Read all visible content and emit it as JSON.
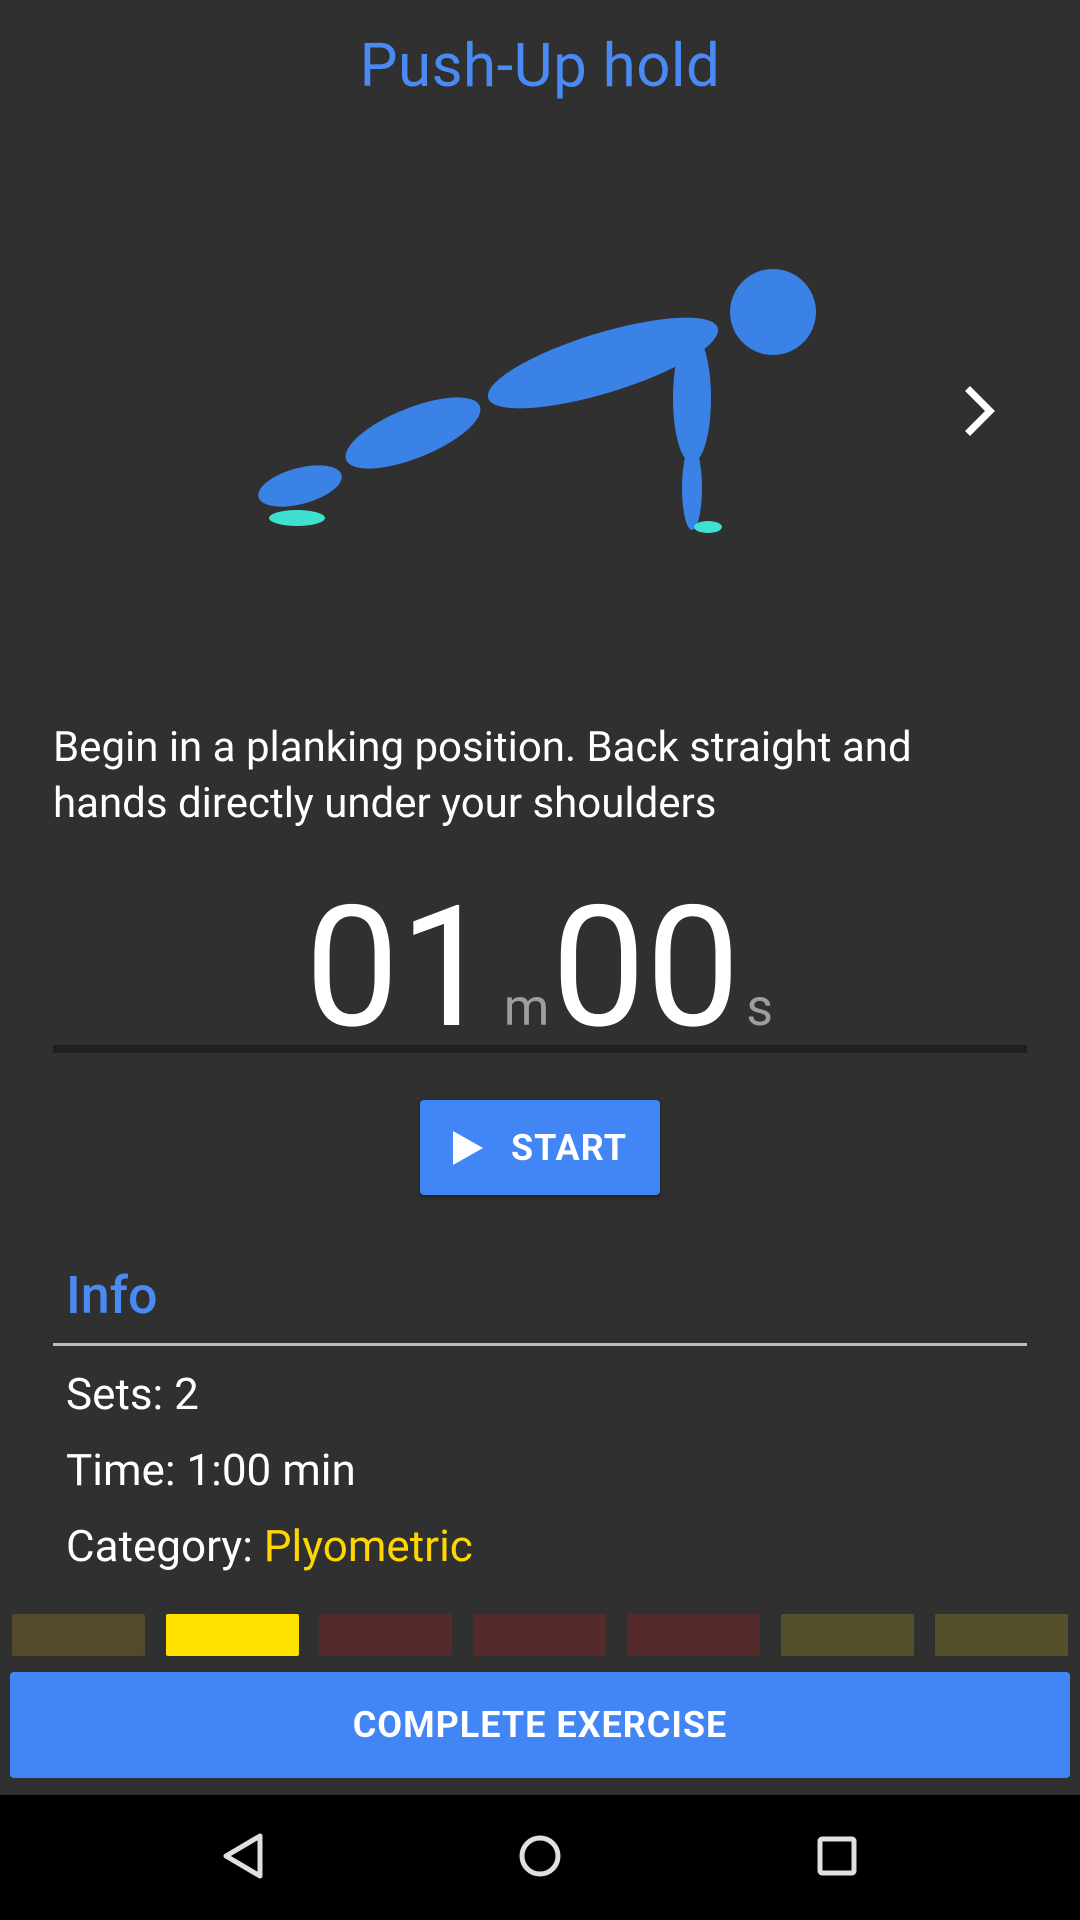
{
  "exercise": {
    "title": "Push-Up hold",
    "description": "Begin in a planking position. Back straight and hands directly under your shoulders"
  },
  "timer": {
    "minutes": "01",
    "minutes_unit": "m",
    "seconds": "00",
    "seconds_unit": "s"
  },
  "start_button": {
    "label": "START",
    "icon": "play-icon"
  },
  "info": {
    "heading": "Info",
    "sets": "Sets: 2",
    "time": "Time: 1:00 min",
    "category_label": "Category: ",
    "category_value": "Plyometric"
  },
  "progress_segments": [
    {
      "color": "#54492a",
      "state": "done"
    },
    {
      "color": "#ffe100",
      "state": "current"
    },
    {
      "color": "#542a2a",
      "state": "upcoming"
    },
    {
      "color": "#542a2a",
      "state": "upcoming"
    },
    {
      "color": "#542a2a",
      "state": "upcoming"
    },
    {
      "color": "#54502a",
      "state": "upcoming"
    },
    {
      "color": "#54502a",
      "state": "upcoming"
    }
  ],
  "complete_button": {
    "label": "COMPLETE EXERCISE"
  },
  "navigation": {
    "next_icon": "chevron-right-icon"
  },
  "system_nav": {
    "back": "back-icon",
    "home": "home-icon",
    "recents": "recents-icon"
  },
  "colors": {
    "accent": "#4285f4",
    "figure": "#3b82e6",
    "floor": "#3fe0d0",
    "category": "#ffd600",
    "background": "#303030"
  }
}
